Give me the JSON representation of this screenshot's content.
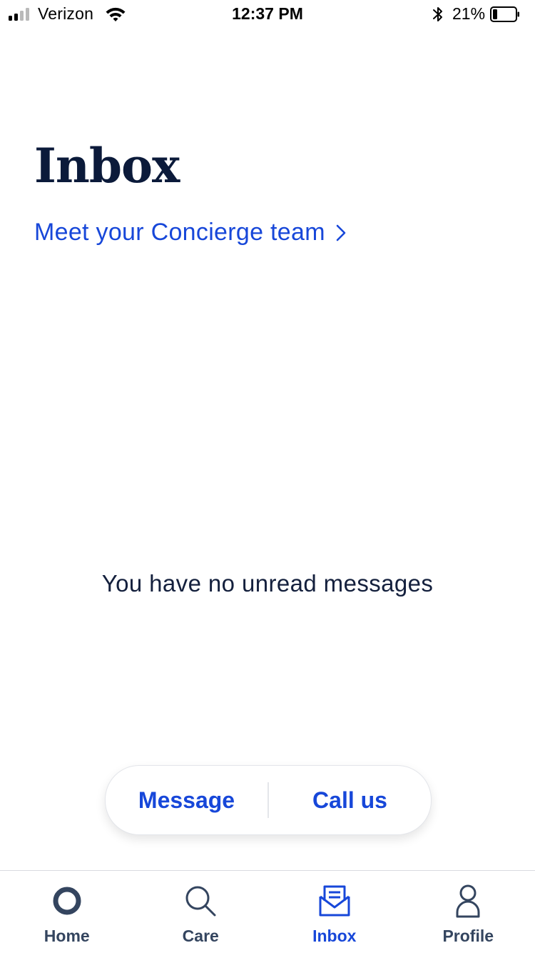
{
  "status_bar": {
    "carrier": "Verizon",
    "time": "12:37 PM",
    "battery_percent": "21%",
    "battery_level": 0.21,
    "icons": [
      "signal-icon",
      "wifi-icon",
      "bluetooth-icon",
      "battery-icon"
    ]
  },
  "header": {
    "title": "Inbox",
    "concierge_link": "Meet your Concierge team"
  },
  "main": {
    "empty_message": "You have no unread messages"
  },
  "contact": {
    "message_label": "Message",
    "call_label": "Call us"
  },
  "tabs": [
    {
      "label": "Home",
      "icon": "home-ring-icon",
      "active": false
    },
    {
      "label": "Care",
      "icon": "search-icon",
      "active": false
    },
    {
      "label": "Inbox",
      "icon": "inbox-envelope-icon",
      "active": true
    },
    {
      "label": "Profile",
      "icon": "person-icon",
      "active": false
    }
  ],
  "colors": {
    "accent": "#1747d9",
    "title": "#0b1a3a",
    "tab_inactive": "#34455f",
    "background": "#ffffff"
  }
}
